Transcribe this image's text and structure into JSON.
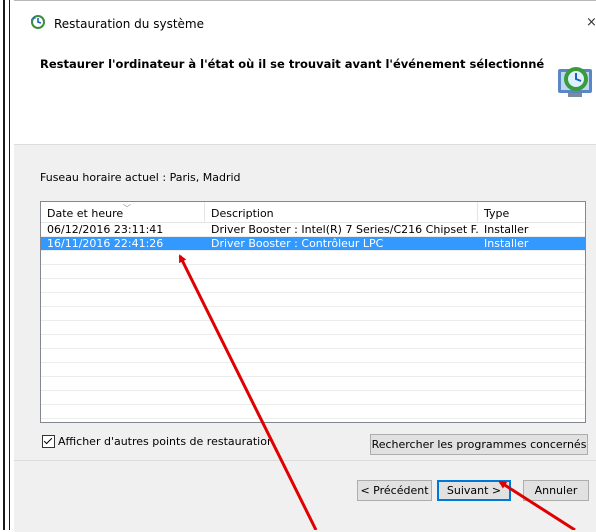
{
  "window": {
    "title": "Restauration du système"
  },
  "header": {
    "instruction": "Restaurer l'ordinateur à l'état où il se trouvait avant l'événement sélectionné"
  },
  "timezone": "Fuseau horaire actuel : Paris, Madrid",
  "table": {
    "columns": [
      "Date et heure",
      "Description",
      "Type"
    ],
    "rows": [
      {
        "date": "06/12/2016 23:11:41",
        "description": "Driver Booster : Intel(R) 7 Series/C216 Chipset F...",
        "type": "Installer",
        "selected": false
      },
      {
        "date": "16/11/2016 22:41:26",
        "description": "Driver Booster : Contrôleur LPC",
        "type": "Installer",
        "selected": true
      }
    ]
  },
  "options": {
    "show_more_label": "Afficher d'autres points de restauration",
    "show_more_checked": true
  },
  "buttons": {
    "search_label": "Rechercher les programmes concernés",
    "prev_label": "< Précédent",
    "next_label": "Suivant >",
    "cancel_label": "Annuler"
  },
  "colors": {
    "selection": "#3399ff",
    "annotation_arrow": "#e00000",
    "focus_border": "#0078d7"
  },
  "icons": [
    "system-restore-icon",
    "close-icon",
    "sort-caret-icon",
    "system-restore-illustration-icon",
    "checkmark-icon"
  ]
}
